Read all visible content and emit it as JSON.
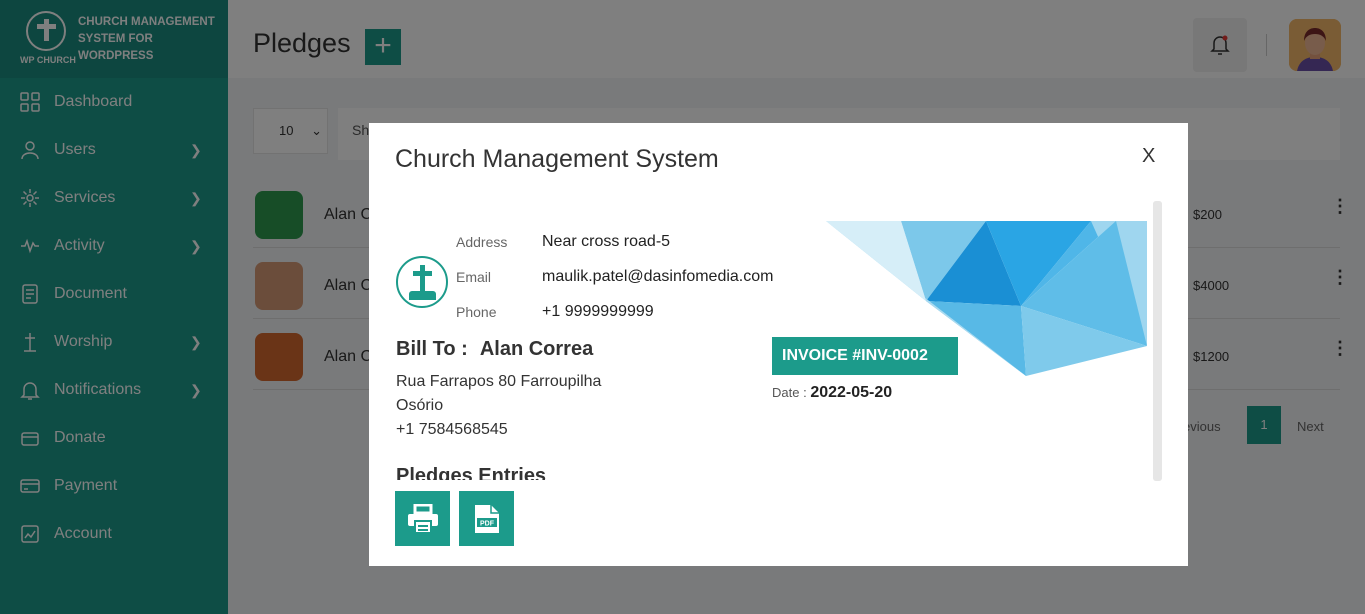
{
  "brand": {
    "wp_label": "WP CHURCH",
    "text": "CHURCH MANAGEMENT SYSTEM FOR WORDPRESS"
  },
  "sidebar": {
    "items": [
      {
        "label": "Dashboard",
        "icon": "dashboard-icon"
      },
      {
        "label": "Users",
        "icon": "user-icon"
      },
      {
        "label": "Services",
        "icon": "services-icon"
      },
      {
        "label": "Activity",
        "icon": "activity-icon"
      },
      {
        "label": "Document",
        "icon": "document-icon"
      },
      {
        "label": "Worship",
        "icon": "worship-icon"
      },
      {
        "label": "Notifications",
        "icon": "bell-icon"
      },
      {
        "label": "Donate",
        "icon": "donate-icon"
      },
      {
        "label": "Payment",
        "icon": "payment-icon"
      },
      {
        "label": "Account",
        "icon": "account-icon"
      }
    ]
  },
  "header": {
    "title": "Pledges",
    "add_label": "+"
  },
  "table": {
    "page_length": "10",
    "search_hint": "Sh",
    "rows": [
      {
        "name": "Alan C",
        "amount": "$200"
      },
      {
        "name": "Alan C",
        "amount": "$4000"
      },
      {
        "name": "Alan C",
        "amount": "$1200"
      }
    ],
    "pager": {
      "prev": "evious",
      "page": "1",
      "next": "Next"
    }
  },
  "modal": {
    "title": "Church Management System",
    "close": "X",
    "org": {
      "address_label": "Address",
      "address": "Near cross road-5",
      "email_label": "Email",
      "email": "maulik.patel@dasinfomedia.com",
      "phone_label": "Phone",
      "phone": "+1 9999999999"
    },
    "bill_to_label": "Bill To :",
    "bill_to_name": "Alan Correa",
    "bill_lines": [
      "Rua Farrapos 80 Farroupilha",
      "Osório",
      "+1 7584568545"
    ],
    "invoice_label": "INVOICE #INV-0002",
    "date_label": "Date :",
    "date": "2022-05-20",
    "entries_title": "Pledges Entries"
  },
  "colors": {
    "accent": "#1c9b8b",
    "sidebar": "#1c9b8b"
  }
}
